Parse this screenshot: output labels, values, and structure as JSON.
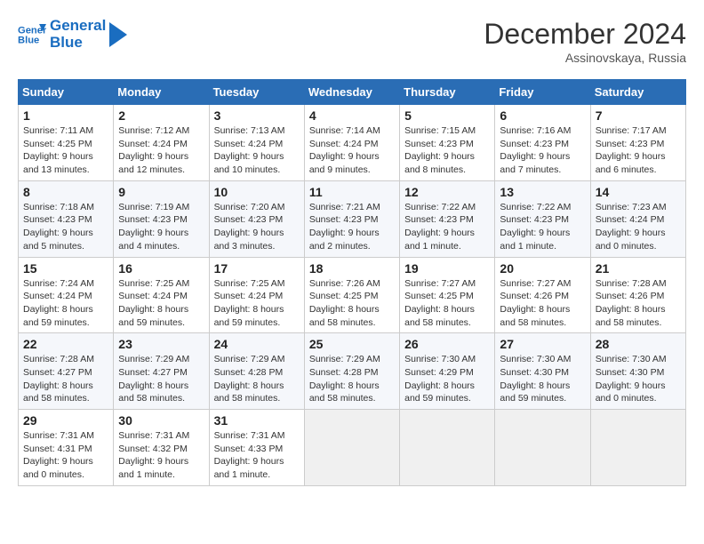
{
  "header": {
    "logo_line1": "General",
    "logo_line2": "Blue",
    "month": "December 2024",
    "location": "Assinovskaya, Russia"
  },
  "weekdays": [
    "Sunday",
    "Monday",
    "Tuesday",
    "Wednesday",
    "Thursday",
    "Friday",
    "Saturday"
  ],
  "weeks": [
    [
      {
        "day": "1",
        "info": "Sunrise: 7:11 AM\nSunset: 4:25 PM\nDaylight: 9 hours\nand 13 minutes."
      },
      {
        "day": "2",
        "info": "Sunrise: 7:12 AM\nSunset: 4:24 PM\nDaylight: 9 hours\nand 12 minutes."
      },
      {
        "day": "3",
        "info": "Sunrise: 7:13 AM\nSunset: 4:24 PM\nDaylight: 9 hours\nand 10 minutes."
      },
      {
        "day": "4",
        "info": "Sunrise: 7:14 AM\nSunset: 4:24 PM\nDaylight: 9 hours\nand 9 minutes."
      },
      {
        "day": "5",
        "info": "Sunrise: 7:15 AM\nSunset: 4:23 PM\nDaylight: 9 hours\nand 8 minutes."
      },
      {
        "day": "6",
        "info": "Sunrise: 7:16 AM\nSunset: 4:23 PM\nDaylight: 9 hours\nand 7 minutes."
      },
      {
        "day": "7",
        "info": "Sunrise: 7:17 AM\nSunset: 4:23 PM\nDaylight: 9 hours\nand 6 minutes."
      }
    ],
    [
      {
        "day": "8",
        "info": "Sunrise: 7:18 AM\nSunset: 4:23 PM\nDaylight: 9 hours\nand 5 minutes."
      },
      {
        "day": "9",
        "info": "Sunrise: 7:19 AM\nSunset: 4:23 PM\nDaylight: 9 hours\nand 4 minutes."
      },
      {
        "day": "10",
        "info": "Sunrise: 7:20 AM\nSunset: 4:23 PM\nDaylight: 9 hours\nand 3 minutes."
      },
      {
        "day": "11",
        "info": "Sunrise: 7:21 AM\nSunset: 4:23 PM\nDaylight: 9 hours\nand 2 minutes."
      },
      {
        "day": "12",
        "info": "Sunrise: 7:22 AM\nSunset: 4:23 PM\nDaylight: 9 hours\nand 1 minute."
      },
      {
        "day": "13",
        "info": "Sunrise: 7:22 AM\nSunset: 4:23 PM\nDaylight: 9 hours\nand 1 minute."
      },
      {
        "day": "14",
        "info": "Sunrise: 7:23 AM\nSunset: 4:24 PM\nDaylight: 9 hours\nand 0 minutes."
      }
    ],
    [
      {
        "day": "15",
        "info": "Sunrise: 7:24 AM\nSunset: 4:24 PM\nDaylight: 8 hours\nand 59 minutes."
      },
      {
        "day": "16",
        "info": "Sunrise: 7:25 AM\nSunset: 4:24 PM\nDaylight: 8 hours\nand 59 minutes."
      },
      {
        "day": "17",
        "info": "Sunrise: 7:25 AM\nSunset: 4:24 PM\nDaylight: 8 hours\nand 59 minutes."
      },
      {
        "day": "18",
        "info": "Sunrise: 7:26 AM\nSunset: 4:25 PM\nDaylight: 8 hours\nand 58 minutes."
      },
      {
        "day": "19",
        "info": "Sunrise: 7:27 AM\nSunset: 4:25 PM\nDaylight: 8 hours\nand 58 minutes."
      },
      {
        "day": "20",
        "info": "Sunrise: 7:27 AM\nSunset: 4:26 PM\nDaylight: 8 hours\nand 58 minutes."
      },
      {
        "day": "21",
        "info": "Sunrise: 7:28 AM\nSunset: 4:26 PM\nDaylight: 8 hours\nand 58 minutes."
      }
    ],
    [
      {
        "day": "22",
        "info": "Sunrise: 7:28 AM\nSunset: 4:27 PM\nDaylight: 8 hours\nand 58 minutes."
      },
      {
        "day": "23",
        "info": "Sunrise: 7:29 AM\nSunset: 4:27 PM\nDaylight: 8 hours\nand 58 minutes."
      },
      {
        "day": "24",
        "info": "Sunrise: 7:29 AM\nSunset: 4:28 PM\nDaylight: 8 hours\nand 58 minutes."
      },
      {
        "day": "25",
        "info": "Sunrise: 7:29 AM\nSunset: 4:28 PM\nDaylight: 8 hours\nand 58 minutes."
      },
      {
        "day": "26",
        "info": "Sunrise: 7:30 AM\nSunset: 4:29 PM\nDaylight: 8 hours\nand 59 minutes."
      },
      {
        "day": "27",
        "info": "Sunrise: 7:30 AM\nSunset: 4:30 PM\nDaylight: 8 hours\nand 59 minutes."
      },
      {
        "day": "28",
        "info": "Sunrise: 7:30 AM\nSunset: 4:30 PM\nDaylight: 9 hours\nand 0 minutes."
      }
    ],
    [
      {
        "day": "29",
        "info": "Sunrise: 7:31 AM\nSunset: 4:31 PM\nDaylight: 9 hours\nand 0 minutes."
      },
      {
        "day": "30",
        "info": "Sunrise: 7:31 AM\nSunset: 4:32 PM\nDaylight: 9 hours\nand 1 minute."
      },
      {
        "day": "31",
        "info": "Sunrise: 7:31 AM\nSunset: 4:33 PM\nDaylight: 9 hours\nand 1 minute."
      },
      null,
      null,
      null,
      null
    ]
  ]
}
